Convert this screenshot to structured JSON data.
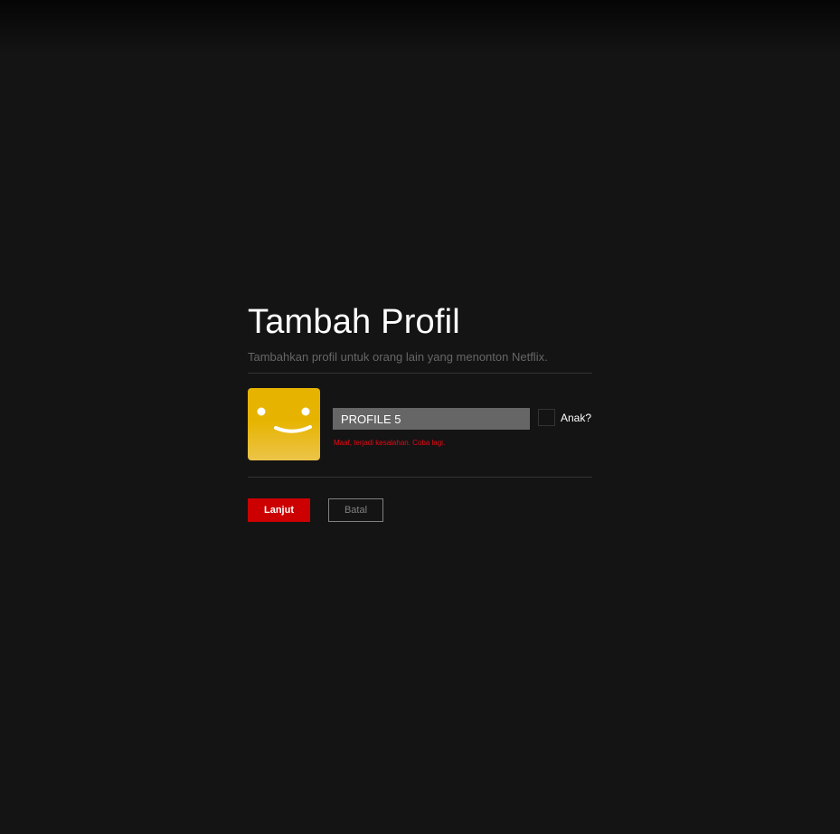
{
  "page": {
    "title": "Tambah Profil",
    "subtitle": "Tambahkan profil untuk orang lain yang menonton Netflix."
  },
  "profile_form": {
    "avatar_icon": "smiley-face-icon",
    "avatar_color": "#e6b400",
    "name_value": "PROFILE 5",
    "kids_label": "Anak?",
    "kids_checked": false,
    "error_message": "Maaf, terjadi kesalahan. Coba lagi."
  },
  "actions": {
    "continue_label": "Lanjut",
    "cancel_label": "Batal"
  },
  "colors": {
    "background": "#141414",
    "accent": "#cc0000",
    "error": "#e50914"
  }
}
